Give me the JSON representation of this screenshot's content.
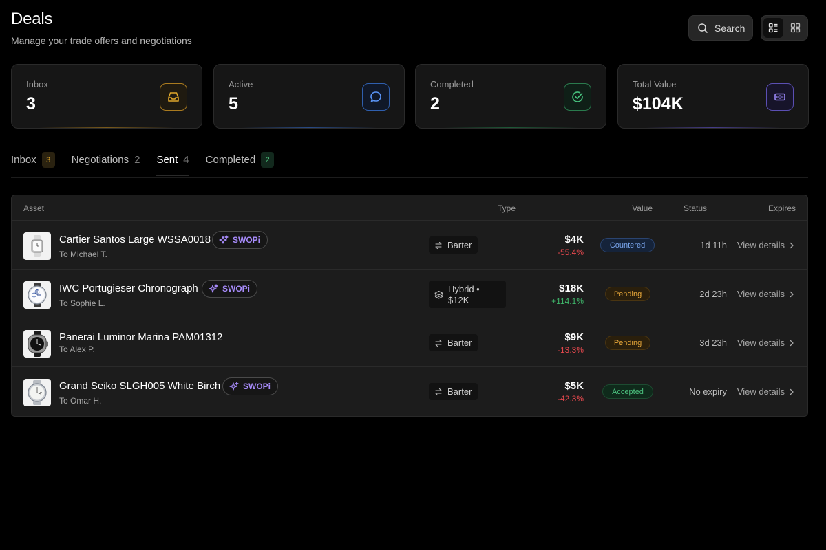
{
  "header": {
    "title": "Deals",
    "subtitle": "Manage your trade offers and negotiations",
    "search_label": "Search"
  },
  "view_toggle": {
    "active": "list"
  },
  "stats": [
    {
      "label": "Inbox",
      "value": "3",
      "icon": "inbox-icon",
      "color": "#e0a72a"
    },
    {
      "label": "Active",
      "value": "5",
      "icon": "chat-bubble-icon",
      "color": "#4f8ef7"
    },
    {
      "label": "Completed",
      "value": "2",
      "icon": "check-circle-icon",
      "color": "#3fb56a"
    },
    {
      "label": "Total Value",
      "value": "$104K",
      "icon": "cash-icon",
      "color": "#8b7cf6"
    }
  ],
  "tabs": [
    {
      "label": "Inbox",
      "count": "3"
    },
    {
      "label": "Negotiations",
      "count": "2"
    },
    {
      "label": "Sent",
      "count": "4",
      "active": true
    },
    {
      "label": "Completed",
      "count": "2"
    }
  ],
  "table": {
    "columns": {
      "asset": "Asset",
      "type": "Type",
      "value": "Value",
      "status": "Status",
      "expires": "Expires"
    },
    "rows": [
      {
        "name": "Cartier Santos Large WSSA0018",
        "to": "To Michael T.",
        "swopi": "SWOPi",
        "type": "Barter",
        "value": "$4K",
        "delta": "-55.4%",
        "status": "Countered",
        "expires": "1d 11h",
        "link": "View details"
      },
      {
        "name": "IWC Portugieser Chronograph",
        "to": "To Sophie L.",
        "swopi": "SWOPi",
        "type_line1": "Hybrid •",
        "type_line2": "$12K",
        "value": "$18K",
        "delta": "+114.1%",
        "status": "Pending",
        "expires": "2d 23h",
        "link": "View details"
      },
      {
        "name": "Panerai Luminor Marina PAM01312",
        "to": "To Alex P.",
        "type": "Barter",
        "value": "$9K",
        "delta": "-13.3%",
        "status": "Pending",
        "expires": "3d 23h",
        "link": "View details"
      },
      {
        "name": "Grand Seiko SLGH005 White Birch",
        "to": "To Omar H.",
        "swopi": "SWOPi",
        "type": "Barter",
        "value": "$5K",
        "delta": "-42.3%",
        "status": "Accepted",
        "expires": "No expiry",
        "link": "View details"
      }
    ]
  }
}
